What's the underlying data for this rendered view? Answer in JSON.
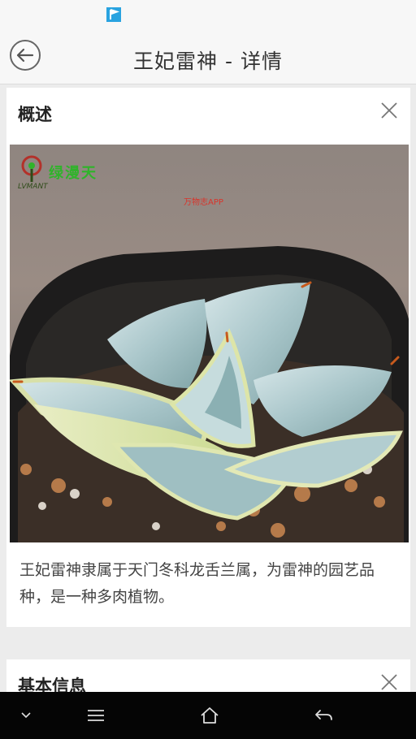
{
  "header": {
    "title": "王妃雷神 - 详情",
    "back_icon": "back-arrow-circle-icon"
  },
  "overview": {
    "title": "概述",
    "close_icon": "close-icon",
    "image": {
      "subject": "succulent-plant-photo",
      "watermark_brand": "绿漫天",
      "watermark_brand_en": "LVMANT",
      "watermark_app": "万物志APP"
    },
    "description": "王妃雷神隶属于天门冬科龙舌兰属，为雷神的园艺品种，是一种多肉植物。"
  },
  "basic_info": {
    "title": "基本信息",
    "close_icon": "close-icon"
  },
  "nav": {
    "icons": [
      "chevron-down-icon",
      "menu-icon",
      "home-icon",
      "back-icon"
    ]
  },
  "colors": {
    "accent_flag": "#29a3e0",
    "nav_bar": "#050505",
    "brand_green": "#2fb42a"
  }
}
